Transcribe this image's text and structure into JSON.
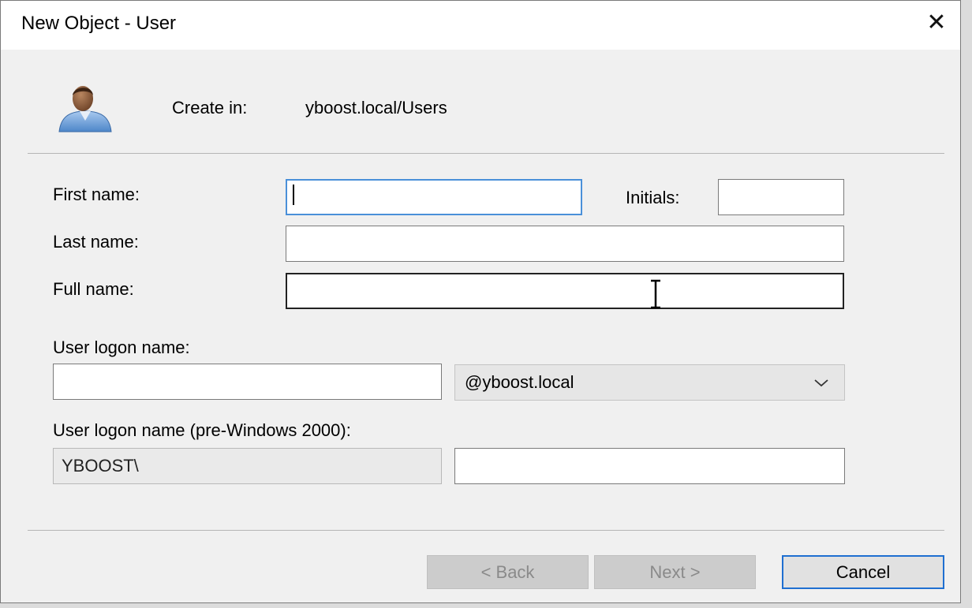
{
  "window": {
    "title": "New Object - User",
    "close_glyph": "✕"
  },
  "header": {
    "icon": "user-icon",
    "create_in_label": "Create in:",
    "create_in_path": "yboost.local/Users"
  },
  "form": {
    "first_name_label": "First name:",
    "first_name_value": "",
    "initials_label": "Initials:",
    "initials_value": "",
    "last_name_label": "Last name:",
    "last_name_value": "",
    "full_name_label": "Full name:",
    "full_name_value": "",
    "logon_name_label": "User logon name:",
    "logon_name_value": "",
    "upn_suffix_selected": "@yboost.local",
    "pre2000_label": "User logon name (pre-Windows 2000):",
    "pre2000_domain": "YBOOST\\",
    "pre2000_value": ""
  },
  "buttons": {
    "back": "< Back",
    "next": "Next >",
    "cancel": "Cancel"
  },
  "colors": {
    "dialog_bg": "#f0f0f0",
    "focus_border": "#4a90d9",
    "default_button_border": "#1f6fd1"
  }
}
